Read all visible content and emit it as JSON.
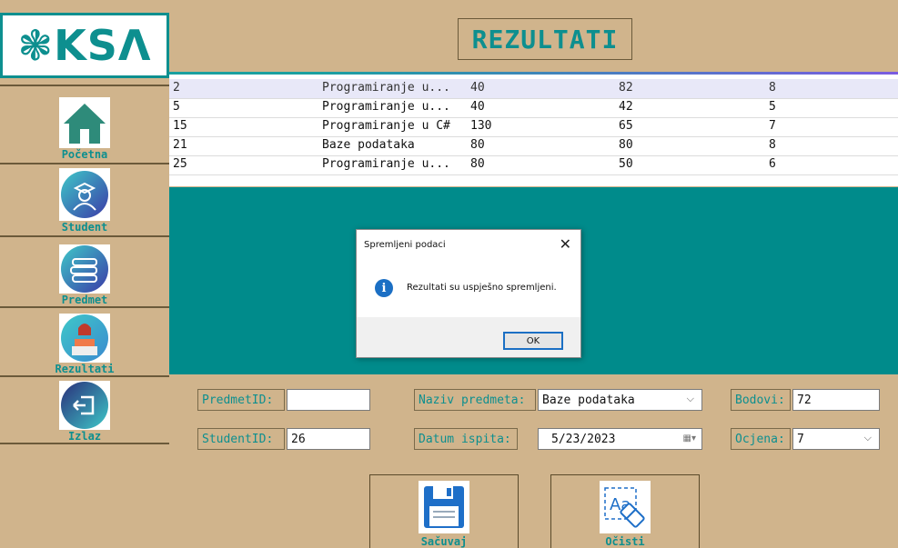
{
  "app": {
    "logo_text": "KSΛ",
    "logo_mark": "❃",
    "title": "REZULTATI",
    "accent_color": "#0d8f8f",
    "background_color": "#d0b48c"
  },
  "sidebar": {
    "items": [
      {
        "label": "Početna",
        "icon": "home-icon"
      },
      {
        "label": "Student",
        "icon": "student-icon"
      },
      {
        "label": "Predmet",
        "icon": "books-icon"
      },
      {
        "label": "Rezultati",
        "icon": "results-icon"
      },
      {
        "label": "Izlaz",
        "icon": "exit-icon"
      }
    ]
  },
  "grid": {
    "rows": [
      [
        "2",
        "Programiranje u...",
        "40",
        "82",
        "8"
      ],
      [
        "5",
        "Programiranje u...",
        "40",
        "42",
        "5"
      ],
      [
        "15",
        "Programiranje u C#",
        "130",
        "65",
        "7"
      ],
      [
        "21",
        "Baze podataka",
        "80",
        "80",
        "8"
      ],
      [
        "25",
        "Programiranje u...",
        "80",
        "50",
        "6"
      ]
    ],
    "selected_row": 0
  },
  "dialog": {
    "title": "Spremljeni podaci",
    "message": "Rezultati su uspješno spremljeni.",
    "ok_label": "OK",
    "icon": "info-icon"
  },
  "form": {
    "predmet_id_label": "PredmetID:",
    "predmet_id_value": "",
    "student_id_label": "StudentID:",
    "student_id_value": "26",
    "naziv_label": "Naziv predmeta:",
    "naziv_value": "Baze podataka",
    "datum_label": "Datum ispita:",
    "datum_value": "5/23/2023",
    "bodovi_label": "Bodovi:",
    "bodovi_value": "72",
    "ocjena_label": "Ocjena:",
    "ocjena_value": "7"
  },
  "buttons": {
    "save_label": "Sačuvaj",
    "clear_label": "Očisti"
  }
}
